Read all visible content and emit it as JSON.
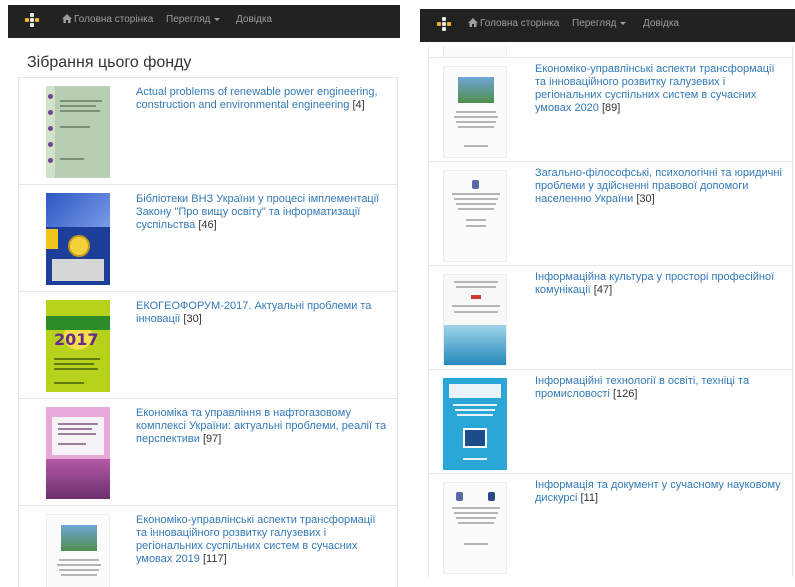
{
  "nav": {
    "home_label": "Головна сторінка",
    "view_label": "Перегляд",
    "help_label": "Довідка"
  },
  "left": {
    "heading": "Зібрання цього фонду",
    "items": [
      {
        "title": "Actual problems of renewable power engineering, construction and environmental engineering",
        "count": "[4]",
        "cover": "green-cover"
      },
      {
        "title": "Бібліотеки ВНЗ України у процесі імплементації Закону \"Про вищу освіту\" та інформатизації суспільства",
        "count": "[46]",
        "cover": "blue-cover"
      },
      {
        "title": "ЕКОГЕОФОРУМ-2017. Актуальні проблеми та інновації",
        "count": "[30]",
        "cover": "lime-cover"
      },
      {
        "title": "Економіка та управління в нафтогазовому комплексі України: актуальні проблеми, реалії та перспективи",
        "count": "[97]",
        "cover": "pink-cover"
      },
      {
        "title": "Економіко-управлінські аспекти трансформації та інноваційного розвитку галузевих і регіональних суспільних систем в сучасних умовах 2019",
        "count": "[117]",
        "cover": "white-cover"
      }
    ]
  },
  "right": {
    "items": [
      {
        "title": "Економіко-управлінські аспекти трансформації та інноваційного розвитку галузевих і регіональних суспільних систем в сучасних умовах 2020",
        "count": "[89]",
        "cover": "white-cover"
      },
      {
        "title": "Загально-філософські, психологічні та юридичні проблеми у здійсненні правової допомоги населенню України",
        "count": "[30]",
        "cover": "white-cover"
      },
      {
        "title": "Інформаційна культура у просторі професійної комунікації",
        "count": "[47]",
        "cover": "wave-cover"
      },
      {
        "title": "Інформаційні технології в освіті, техніці та промисловості",
        "count": "[126]",
        "cover": "cyan-cover"
      },
      {
        "title": "Інформація та документ у сучасному науковому дискурсі",
        "count": "[11]",
        "cover": "white-cover"
      }
    ]
  },
  "colors": {
    "navbar": "#222222",
    "link": "#337ab7",
    "nav_text": "#9d9d9d",
    "accent": "#f0b429"
  }
}
